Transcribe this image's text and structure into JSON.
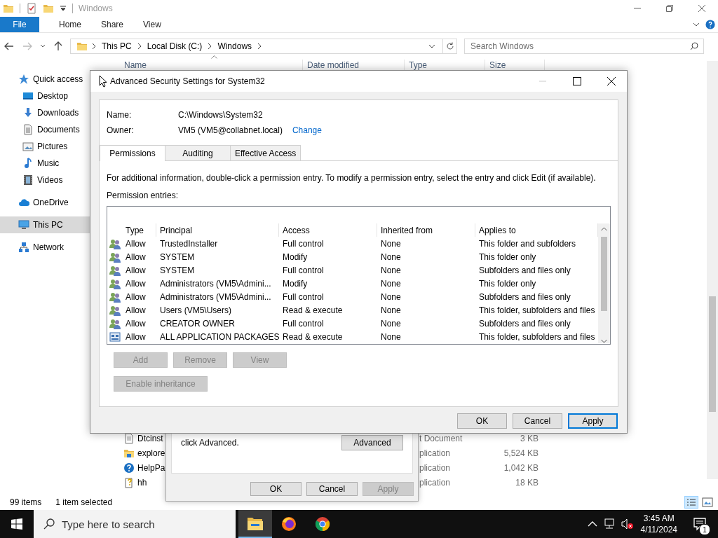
{
  "explorer": {
    "title": "Windows",
    "ribbon_tabs": [
      {
        "label": "File",
        "kind": "file",
        "selected": false
      },
      {
        "label": "Home",
        "kind": "tab",
        "selected": false
      },
      {
        "label": "Share",
        "kind": "tab",
        "selected": false
      },
      {
        "label": "View",
        "kind": "tab",
        "selected": false
      }
    ],
    "breadcrumb": [
      "This PC",
      "Local Disk (C:)",
      "Windows"
    ],
    "search": {
      "placeholder": "Search Windows"
    },
    "nav": [
      {
        "label": "Quick access",
        "kind": "star",
        "selected": false,
        "children": [
          {
            "label": "Desktop",
            "kind": "desktop",
            "selected": false
          },
          {
            "label": "Downloads",
            "kind": "download",
            "selected": false
          },
          {
            "label": "Documents",
            "kind": "documents",
            "selected": false
          },
          {
            "label": "Pictures",
            "kind": "pictures",
            "selected": false
          },
          {
            "label": "Music",
            "kind": "music",
            "selected": false
          },
          {
            "label": "Videos",
            "kind": "videos",
            "selected": false
          }
        ]
      },
      {
        "label": "OneDrive",
        "kind": "cloud",
        "selected": false
      },
      {
        "label": "This PC",
        "kind": "pc",
        "selected": true
      },
      {
        "label": "Network",
        "kind": "network",
        "selected": false
      }
    ],
    "columns": [
      "Name",
      "Date modified",
      "Type",
      "Size"
    ],
    "files": [
      {
        "name": "Dtcinst",
        "type": "t Document",
        "size": "3 KB",
        "kind": "text"
      },
      {
        "name": "explore",
        "type": "plication",
        "size": "5,524 KB",
        "kind": "explorer"
      },
      {
        "name": "HelpPa",
        "type": "plication",
        "size": "1,042 KB",
        "kind": "help"
      },
      {
        "name": "hh",
        "type": "plication",
        "size": "18 KB",
        "kind": "helpfile"
      }
    ],
    "status": {
      "items": "99 items",
      "selection": "1 item selected"
    }
  },
  "properties_dialog": {
    "text": "click Advanced.",
    "advanced_button": "Advanced",
    "buttons": [
      {
        "label": "OK",
        "disabled": false
      },
      {
        "label": "Cancel",
        "disabled": false
      },
      {
        "label": "Apply",
        "disabled": true
      }
    ]
  },
  "advanced_dialog": {
    "title": "Advanced Security Settings for System32",
    "name_label": "Name:",
    "name_value": "C:\\Windows\\System32",
    "owner_label": "Owner:",
    "owner_value": "VM5 (VM5@collabnet.local)",
    "change_link": "Change",
    "tabs": [
      {
        "label": "Permissions",
        "selected": true
      },
      {
        "label": "Auditing",
        "selected": false
      },
      {
        "label": "Effective Access",
        "selected": false
      }
    ],
    "info": "For additional information, double-click a permission entry. To modify a permission entry, select the entry and click Edit (if available).",
    "entries_label": "Permission entries:",
    "columns": [
      "Type",
      "Principal",
      "Access",
      "Inherited from",
      "Applies to"
    ],
    "entries": [
      {
        "kind": "group",
        "type": "Allow",
        "principal": "TrustedInstaller",
        "access": "Full control",
        "inherited_from": "None",
        "applies_to": "This folder and subfolders"
      },
      {
        "kind": "group",
        "type": "Allow",
        "principal": "SYSTEM",
        "access": "Modify",
        "inherited_from": "None",
        "applies_to": "This folder only"
      },
      {
        "kind": "group",
        "type": "Allow",
        "principal": "SYSTEM",
        "access": "Full control",
        "inherited_from": "None",
        "applies_to": "Subfolders and files only"
      },
      {
        "kind": "group",
        "type": "Allow",
        "principal": "Administrators (VM5\\Admini...",
        "access": "Modify",
        "inherited_from": "None",
        "applies_to": "This folder only"
      },
      {
        "kind": "group",
        "type": "Allow",
        "principal": "Administrators (VM5\\Admini...",
        "access": "Full control",
        "inherited_from": "None",
        "applies_to": "Subfolders and files only"
      },
      {
        "kind": "group",
        "type": "Allow",
        "principal": "Users (VM5\\Users)",
        "access": "Read & execute",
        "inherited_from": "None",
        "applies_to": "This folder, subfolders and files"
      },
      {
        "kind": "group",
        "type": "Allow",
        "principal": "CREATOR OWNER",
        "access": "Full control",
        "inherited_from": "None",
        "applies_to": "Subfolders and files only"
      },
      {
        "kind": "package",
        "type": "Allow",
        "principal": "ALL APPLICATION PACKAGES",
        "access": "Read & execute",
        "inherited_from": "None",
        "applies_to": "This folder, subfolders and files"
      }
    ],
    "actions": [
      {
        "label": "Add",
        "disabled": true
      },
      {
        "label": "Remove",
        "disabled": true
      },
      {
        "label": "View",
        "disabled": true
      }
    ],
    "inheritance_button": {
      "label": "Enable inheritance",
      "disabled": true
    },
    "buttons": [
      {
        "label": "OK",
        "focused": false
      },
      {
        "label": "Cancel",
        "focused": false
      },
      {
        "label": "Apply",
        "focused": true
      }
    ]
  },
  "taskbar": {
    "search_placeholder": "Type here to search",
    "apps": [
      {
        "kind": "explorer",
        "active": true
      },
      {
        "kind": "firefox",
        "active": false
      },
      {
        "kind": "chrome",
        "active": false
      }
    ],
    "time": "3:45 AM",
    "date": "4/11/2024",
    "notifications": "1"
  }
}
